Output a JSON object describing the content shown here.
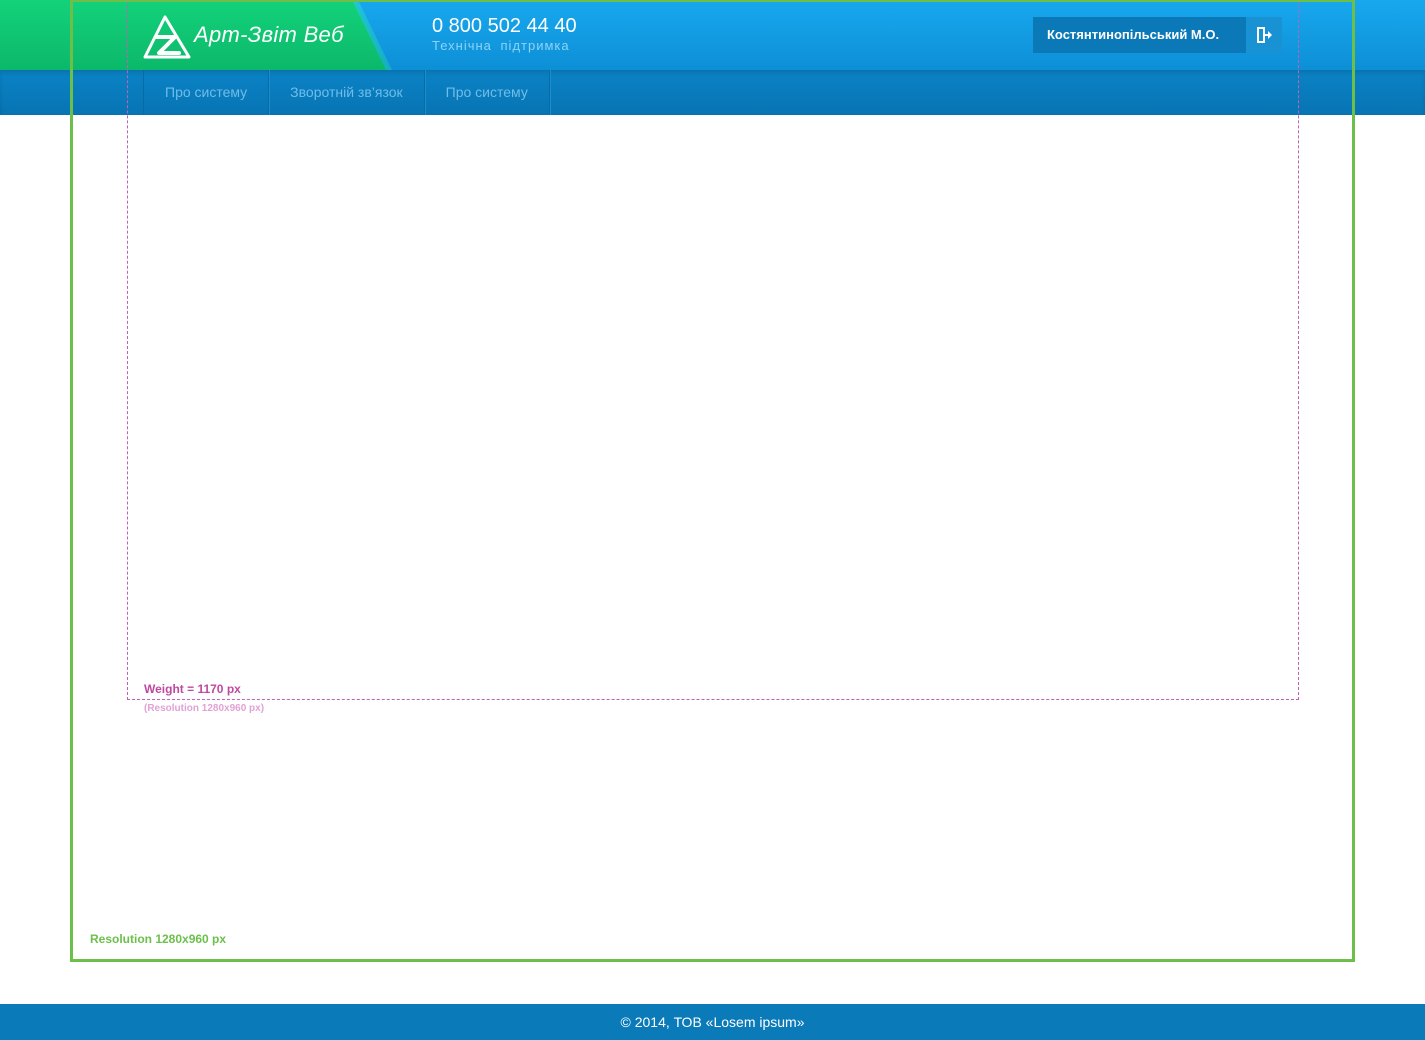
{
  "header": {
    "logo_text": "Арт-Звіт Веб",
    "phone": "0 800 502 44 40",
    "support_label": "Технічна  підтримка",
    "user_name": "Костянтинопільський М.О.",
    "logout_icon": "logout-icon"
  },
  "nav": {
    "items": [
      {
        "label": "Про систему"
      },
      {
        "label": "Зворотній зв’язок"
      },
      {
        "label": "Про систему"
      }
    ]
  },
  "annotations": {
    "content_width_label": "Weight = 1170 px",
    "content_resolution_label": "(Resolution 1280x960 px)",
    "frame_label": "Resolution 1280x960 px"
  },
  "footer": {
    "copyright": "© 2014, ТОВ «Losem ipsum»"
  },
  "colors": {
    "brand_green": "#13d27a",
    "header_blue": "#18a8ee",
    "nav_blue": "#0a83c6",
    "footer_blue": "#0a7ab8",
    "frame_green": "#6cc04a",
    "frame_pink": "#c060b8"
  }
}
